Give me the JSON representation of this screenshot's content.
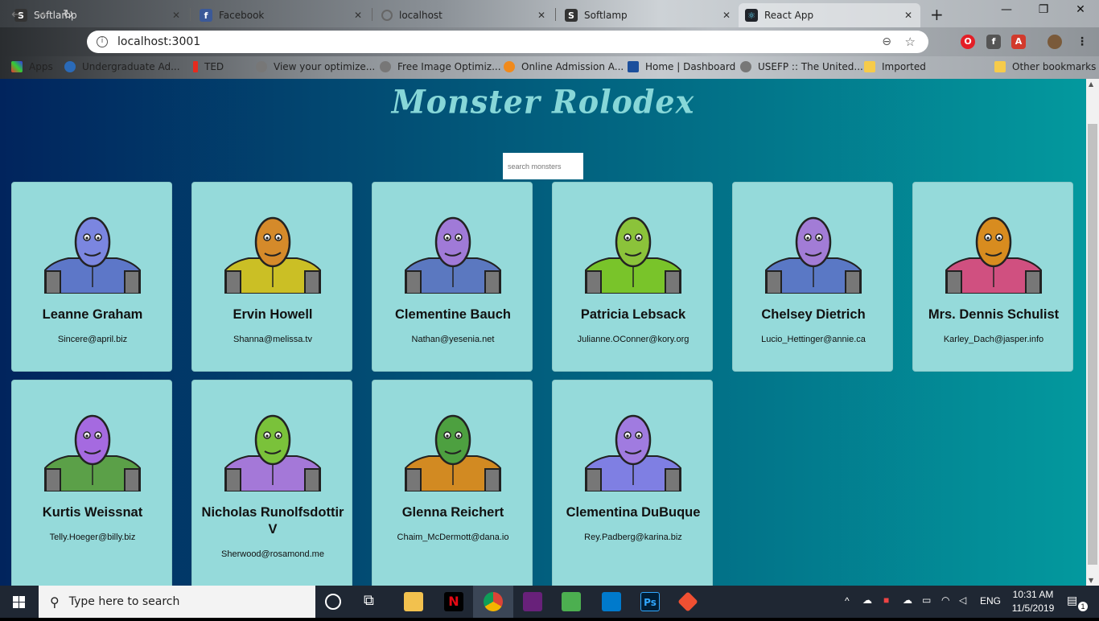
{
  "browser": {
    "tabs": [
      {
        "label": "Softlamp",
        "favicon": "S",
        "active": false
      },
      {
        "label": "Facebook",
        "favicon": "f",
        "active": false
      },
      {
        "label": "localhost",
        "favicon": "globe",
        "active": false
      },
      {
        "label": "Softlamp",
        "favicon": "S",
        "active": false
      },
      {
        "label": "React App",
        "favicon": "react",
        "active": true
      }
    ],
    "new_tab": "+",
    "window_controls": {
      "minimize": "—",
      "restore": "❐",
      "close": "✕"
    },
    "url": "localhost:3001",
    "bookmarks": [
      {
        "label": "Apps"
      },
      {
        "label": "Undergraduate Ad..."
      },
      {
        "label": "TED"
      },
      {
        "label": "View your optimize..."
      },
      {
        "label": "Free Image Optimiz..."
      },
      {
        "label": "Online Admission A..."
      },
      {
        "label": "Home | Dashboard"
      },
      {
        "label": "USEFP :: The United..."
      },
      {
        "label": "Imported"
      },
      {
        "label": "Other bookmarks"
      }
    ]
  },
  "app": {
    "title": "Monster Rolodex",
    "search_placeholder": "search monsters",
    "monsters": [
      {
        "name": "Leanne Graham",
        "email": "Sincere@april.biz",
        "head": "#7b86e0",
        "body": "#5d77c8",
        "skin": "#8c7ee6"
      },
      {
        "name": "Ervin Howell",
        "email": "Shanna@melissa.tv",
        "head": "#d58a2a",
        "body": "#cbbf25",
        "skin": "#d99a31"
      },
      {
        "name": "Clementine Bauch",
        "email": "Nathan@yesenia.net",
        "head": "#a07ad8",
        "body": "#5b78c0",
        "skin": "#a881da"
      },
      {
        "name": "Patricia Lebsack",
        "email": "Julianne.OConner@kory.org",
        "head": "#8bc33a",
        "body": "#79c42a",
        "skin": "#8fc23e"
      },
      {
        "name": "Chelsey Dietrich",
        "email": "Lucio_Hettinger@annie.ca",
        "head": "#a27cd6",
        "body": "#5a78c5",
        "skin": "#a584d8"
      },
      {
        "name": "Mrs. Dennis Schulist",
        "email": "Karley_Dach@jasper.info",
        "head": "#d88c1f",
        "body": "#d05080",
        "skin": "#d7931f"
      },
      {
        "name": "Kurtis Weissnat",
        "email": "Telly.Hoeger@billy.biz",
        "head": "#a56ae0",
        "body": "#5ba048",
        "skin": "#a874df"
      },
      {
        "name": "Nicholas Runolfsdottir V",
        "email": "Sherwood@rosamond.me",
        "head": "#7ac23a",
        "body": "#a478d8",
        "skin": "#7cc23c"
      },
      {
        "name": "Glenna Reichert",
        "email": "Chaim_McDermott@dana.io",
        "head": "#4da040",
        "body": "#d28a22",
        "skin": "#50a142"
      },
      {
        "name": "Clementina DuBuque",
        "email": "Rey.Padberg@karina.biz",
        "head": "#a07be0",
        "body": "#7f7fe3",
        "skin": "#a883df"
      }
    ]
  },
  "taskbar": {
    "search_placeholder": "Type here to search",
    "language": "ENG",
    "time": "10:31 AM",
    "date": "11/5/2019",
    "notification_count": "1"
  }
}
